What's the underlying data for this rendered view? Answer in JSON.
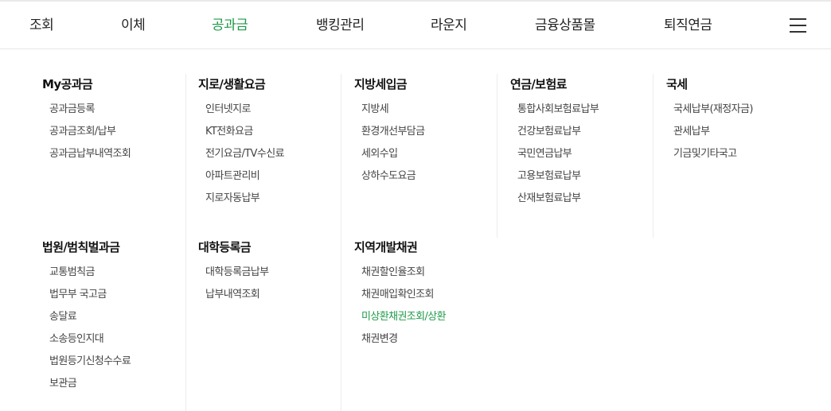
{
  "nav": {
    "items": [
      {
        "label": "조회",
        "active": false
      },
      {
        "label": "이체",
        "active": false
      },
      {
        "label": "공과금",
        "active": true
      },
      {
        "label": "뱅킹관리",
        "active": false
      },
      {
        "label": "라운지",
        "active": false
      },
      {
        "label": "금융상품몰",
        "active": false
      },
      {
        "label": "퇴직연금",
        "active": false
      }
    ],
    "menu_icon": "hamburger-menu-icon",
    "active_color": "#1f9a48"
  },
  "menu": {
    "groups": [
      {
        "title": "My공과금",
        "items": [
          "공과금등록",
          "공과금조회/납부",
          "공과금납부내역조회"
        ]
      },
      {
        "title": "지로/생활요금",
        "items": [
          "인터넷지로",
          "KT전화요금",
          "전기요금/TV수신료",
          "아파트관리비",
          "지로자동납부"
        ]
      },
      {
        "title": "지방세입금",
        "items": [
          "지방세",
          "환경개선부담금",
          "세외수입",
          "상하수도요금"
        ]
      },
      {
        "title": "연금/보험료",
        "items": [
          "통합사회보험료납부",
          "건강보험료납부",
          "국민연금납부",
          "고용보험료납부",
          "산재보험료납부"
        ]
      },
      {
        "title": "국세",
        "items": [
          "국세납부(재정자금)",
          "관세납부",
          "기금및기타국고"
        ]
      },
      {
        "title": "법원/범칙벌과금",
        "items": [
          "교통범칙금",
          "법무부 국고금",
          "송달료",
          "소송등인지대",
          "법원등기신청수수료",
          "보관금"
        ]
      },
      {
        "title": "대학등록금",
        "items": [
          "대학등록금납부",
          "납부내역조회"
        ]
      },
      {
        "title": "지역개발채권",
        "items": [
          "채권할인율조회",
          "채권매입확인조회",
          "미상환채권조회/상환",
          "채권변경"
        ]
      }
    ],
    "active_item": "미상환채권조회/상환"
  }
}
